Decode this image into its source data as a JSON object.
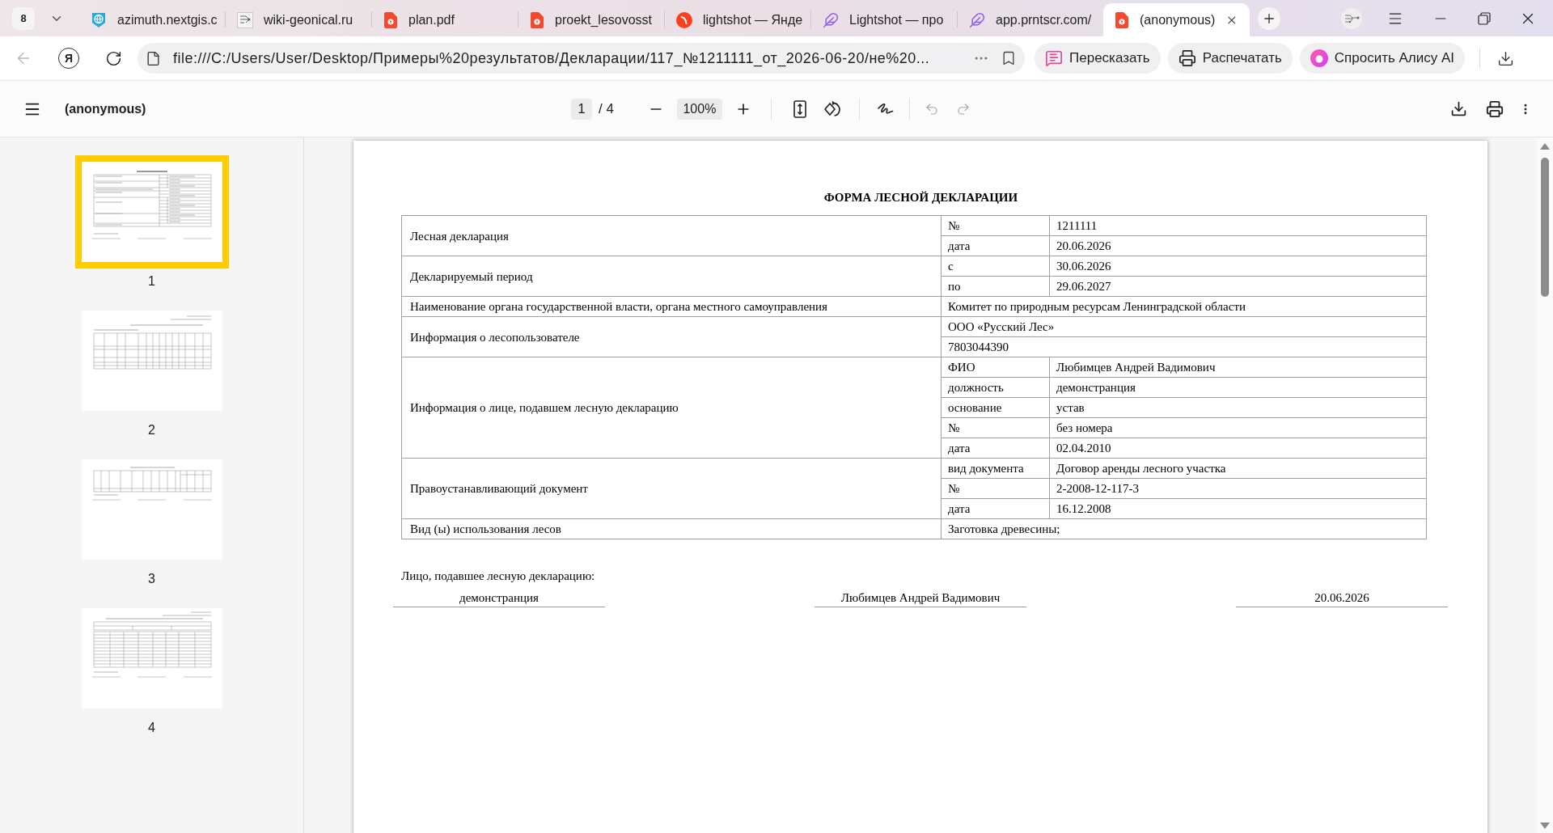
{
  "browser": {
    "tab_count": "8",
    "tabs": [
      {
        "title": "azimuth.nextgis.c",
        "kind": "globe",
        "selected": false
      },
      {
        "title": "wiki-geonical.ru",
        "kind": "site",
        "selected": false
      },
      {
        "title": "plan.pdf",
        "kind": "pdf",
        "selected": false
      },
      {
        "title": "proekt_lesovosst",
        "kind": "pdf",
        "selected": false
      },
      {
        "title": "lightshot — Янде",
        "kind": "yandex",
        "selected": false
      },
      {
        "title": "Lightshot — про",
        "kind": "feather",
        "selected": false
      },
      {
        "title": "app.prntscr.com/",
        "kind": "feather",
        "selected": false
      },
      {
        "title": "(anonymous)",
        "kind": "pdf",
        "selected": true
      }
    ],
    "back_disabled": true,
    "home_button": "Я",
    "address": "file:///C:/Users/User/Desktop/Примеры%20результатов/Декларации/117_№1211111_от_2026-06-20/не%20...",
    "actions": [
      {
        "label": "Пересказать",
        "kind": "retell"
      },
      {
        "label": "Распечатать",
        "kind": "print"
      },
      {
        "label": "Спросить Алису AI",
        "kind": "alice"
      }
    ]
  },
  "viewer": {
    "title": "(anonymous)",
    "page": "1",
    "page_total": "/ 4",
    "zoom": "100%",
    "undo_disabled": true,
    "redo_disabled": true
  },
  "thumbnails": [
    {
      "label": "1",
      "selected": true
    },
    {
      "label": "2",
      "selected": false
    },
    {
      "label": "3",
      "selected": false
    },
    {
      "label": "4",
      "selected": false
    }
  ],
  "document": {
    "title": "ФОРМА ЛЕСНОЙ ДЕКЛАРАЦИИ",
    "rows": [
      {
        "label": "Лесная декларация",
        "entries": [
          {
            "field": "№",
            "value": "1211111"
          },
          {
            "field": "дата",
            "value": "20.06.2026"
          }
        ]
      },
      {
        "label": "Декларируемый период",
        "entries": [
          {
            "field": "с",
            "value": "30.06.2026"
          },
          {
            "field": "по",
            "value": "29.06.2027"
          }
        ]
      },
      {
        "label": "Наименование органа государственной власти, органа местного самоуправления",
        "entries": [
          {
            "value": "Комитет по природным ресурсам Ленинградской области"
          }
        ]
      },
      {
        "label": "Информация о лесопользователе",
        "entries": [
          {
            "value": "ООО «Русский Лес»"
          },
          {
            "value": "7803044390"
          }
        ]
      },
      {
        "label": "Информация о лице, подавшем лесную декларацию",
        "entries": [
          {
            "field": "ФИО",
            "value": "Любимцев Андрей Вадимович"
          },
          {
            "field": "должность",
            "value": "демонстранция"
          },
          {
            "field": "основание",
            "value": "устав"
          },
          {
            "field": "№",
            "value": "без номера"
          },
          {
            "field": "дата",
            "value": "02.04.2010"
          }
        ]
      },
      {
        "label": "Правоустанавливающий документ",
        "entries": [
          {
            "field": "вид документа",
            "value": "Договор аренды лесного участка"
          },
          {
            "field": "№",
            "value": "2-2008-12-117-3"
          },
          {
            "field": "дата",
            "value": "16.12.2008"
          }
        ]
      },
      {
        "label": "Вид (ы) использования лесов",
        "entries": [
          {
            "value": "Заготовка древесины;"
          }
        ]
      }
    ],
    "signer": {
      "caption": "Лицо, подавшее лесную декларацию:",
      "fields": [
        "демонстранция",
        "Любимцев Андрей Вадимович",
        "20.06.2026"
      ]
    }
  }
}
